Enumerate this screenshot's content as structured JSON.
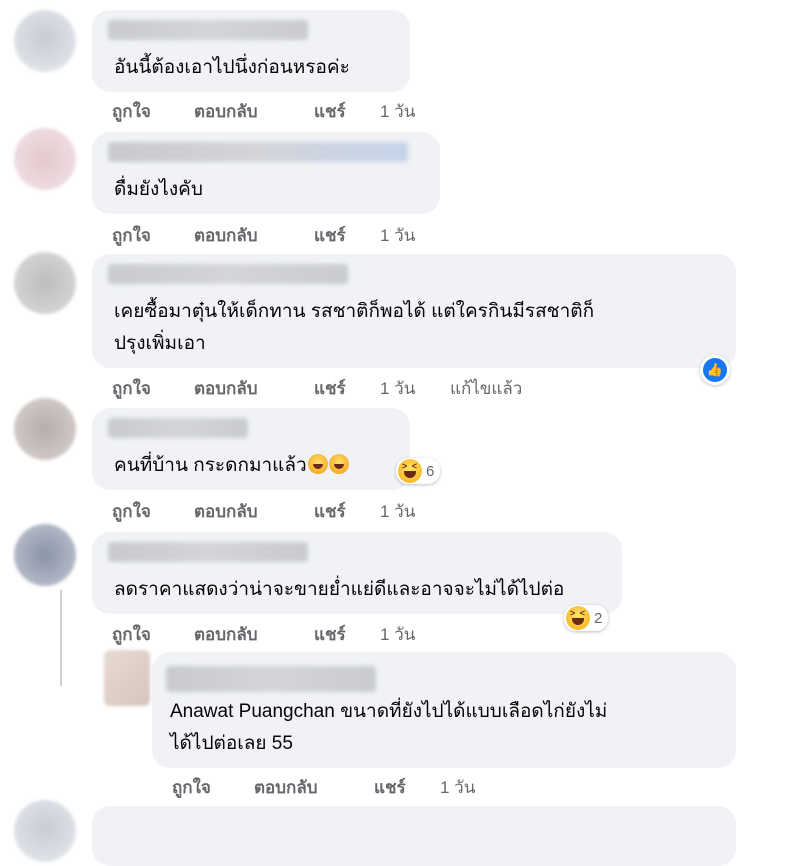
{
  "actions": {
    "like": "ถูกใจ",
    "reply": "ตอบกลับ",
    "share": "แชร์",
    "edited": "แก้ไขแล้ว"
  },
  "comments": [
    {
      "lines": [
        "อันนี้ต้องเอาไปนึ่งก่อนหรอค่ะ"
      ],
      "time": "1 วัน"
    },
    {
      "lines": [
        "ดื่มยังไงคับ"
      ],
      "time": "1 วัน"
    },
    {
      "lines": [
        "เคยซื้อมาตุ๋นให้เด็กทาน รสชาติก็พอได้ แต่ใครกินมีรสชาติก็",
        "ปรุงเพิ่มเอา"
      ],
      "time": "1 วัน",
      "reaction": "like"
    },
    {
      "lines": [
        "คนที่บ้าน กระดกมาแล้ว"
      ],
      "time": "1 วัน",
      "reaction_count": "6"
    },
    {
      "lines": [
        "ลดราคาแสดงว่าน่าจะขายย่ำแย่ดีและอาจจะไม่ได้ไปต่อ"
      ],
      "time": "1 วัน",
      "reaction_count": "2"
    },
    {
      "lines": [
        "Anawat Puangchan ขนาดที่ยังไปได้แบบเลือดไก่ยังไม่",
        "ได้ไปต่อเลย 55"
      ],
      "time": "1 วัน"
    }
  ],
  "colors": {
    "bubble": "#f0f2f5",
    "action_text": "#65676b",
    "like_blue": "#1877f2"
  },
  "icons": [
    "like-reaction-icon",
    "haha-reaction-icon"
  ]
}
